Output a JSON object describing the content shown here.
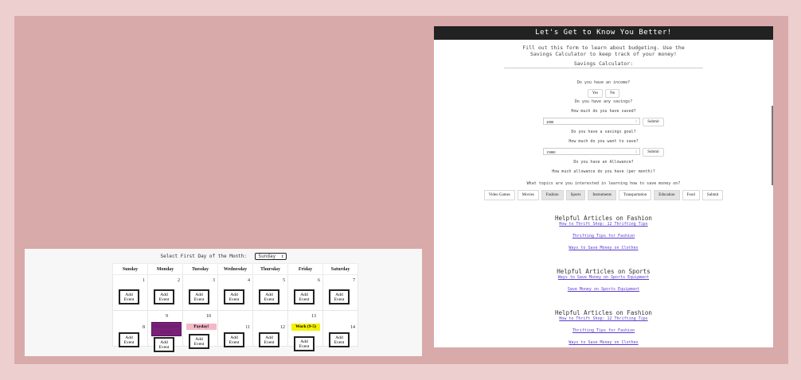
{
  "calendar": {
    "first_day_label": "Select First Day of the Month:",
    "first_day_value": "Sunday",
    "days": [
      "Sunday",
      "Monday",
      "Tuesday",
      "Wednesday",
      "Thursday",
      "Friday",
      "Saturday"
    ],
    "week1": [
      "1",
      "2",
      "3",
      "4",
      "5",
      "6",
      "7"
    ],
    "week2": [
      "8",
      "9",
      "10",
      "11",
      "12",
      "13",
      "14"
    ],
    "add_event_label": "Add Event",
    "event_9": "Shopping with Friend",
    "event_10": "Payday!",
    "event_13": "Work (9-5)",
    "event_colors": {
      "purple": "#7a1f7a",
      "pink": "#f4b9c9",
      "yellow": "#f5f200"
    }
  },
  "form": {
    "header": "Let's Get to Know You Better!",
    "intro_line1": "Fill out this form to learn about budgeting. Use the",
    "intro_line2": "Savings Calculator to keep track of your money!",
    "calc_title": "Savings Calculator:",
    "q_income": "Do you have an income?",
    "yes": "Yes",
    "no": "No",
    "q_savings": "Do you have any savings?",
    "q_saved_amount": "How much do you have saved?",
    "saved_value": "2000",
    "submit": "Submit",
    "q_goal": "Do you have a savings goal?",
    "q_goal_amount": "How much do you want to save?",
    "goal_value": "15000",
    "q_allowance": "Do you have an Allowance?",
    "q_allowance_amount": "How much allowance do you have (per month)?",
    "q_topics": "What topics are you interested in learning how to save money on?",
    "topics": [
      "Video Games",
      "Movies",
      "Fashion",
      "Sports",
      "Instruments",
      "Transportation",
      "Education",
      "Food"
    ],
    "fashion_title": "Helpful Articles on Fashion",
    "fashion_link1": "How to Thrift Shop: 12 Thrifting Tips",
    "fashion_link2": "Thrifting Tips for Fashion",
    "fashion_link3": "Ways to Save Money on Clothes",
    "sports_title": "Helpful Articles on Sports",
    "sports_link1": "Ways to Save Money on Sports Equipment",
    "sports_link2": "Save Money on Sports Equipment",
    "link_color": "#5b3bd1"
  },
  "colors": {
    "page_bg": "#eecfcf",
    "panel_bg": "#d9aaaa",
    "header_bg": "#222222"
  }
}
